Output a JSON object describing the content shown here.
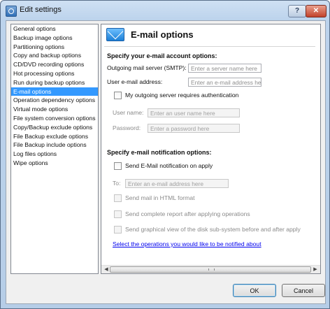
{
  "window": {
    "title": "Edit settings"
  },
  "titlebar": {
    "help_label": "?",
    "close_label": "✕"
  },
  "sidebar": {
    "items": [
      {
        "label": "General options"
      },
      {
        "label": "Backup image options"
      },
      {
        "label": "Partitioning options"
      },
      {
        "label": "Copy and backup options"
      },
      {
        "label": "CD/DVD recording options"
      },
      {
        "label": "Hot processing options"
      },
      {
        "label": "Run during backup options"
      },
      {
        "label": "E-mail options",
        "selected": true
      },
      {
        "label": "Operation dependency options"
      },
      {
        "label": "Virtual mode options"
      },
      {
        "label": "File system conversion options"
      },
      {
        "label": "Copy/Backup exclude options"
      },
      {
        "label": "File Backup exclude options"
      },
      {
        "label": "File Backup include options"
      },
      {
        "label": "Log files options"
      },
      {
        "label": "Wipe options"
      }
    ]
  },
  "panel": {
    "title": "E-mail options",
    "icon": "envelope-icon",
    "account_section": "Specify your e-mail account options:",
    "smtp_label": "Outgoing mail server (SMTP):",
    "smtp_placeholder": "Enter a server name here",
    "email_label": "User e-mail address:",
    "email_placeholder": "Enter an e-mail address here",
    "auth_checkbox": "My outgoing server requires authentication",
    "username_label": "User name:",
    "username_placeholder": "Enter an user name here",
    "password_label": "Password:",
    "password_placeholder": "Enter a password here",
    "notify_section": "Specify e-mail notification options:",
    "send_checkbox": "Send E-Mail notification on apply",
    "to_label": "To:",
    "to_placeholder": "Enter an e-mail address here",
    "html_checkbox": "Send mail in HTML format",
    "report_checkbox": "Send complete report after applying operations",
    "graphical_checkbox": "Send graphical view of the disk sub-system before and after apply",
    "operations_link": "Select the operations you would like to be notified about"
  },
  "buttons": {
    "ok": "OK",
    "cancel": "Cancel"
  },
  "colors": {
    "selection": "#3399ff",
    "link": "#0000ee"
  }
}
